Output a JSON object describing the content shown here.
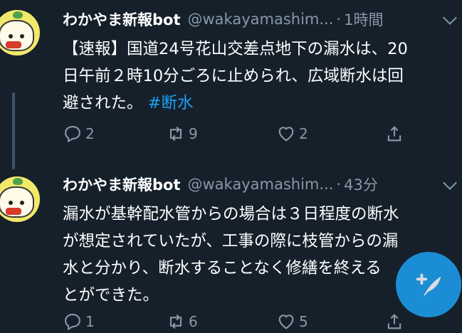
{
  "tweets": [
    {
      "name": "わかやま新報bot",
      "handle": "@wakayamashim...",
      "dot": "·",
      "time": "1時間",
      "lines": [
        "【速報】国道24号花山交差点地下の漏水は、20",
        "日午前２時10分ごろに止められ、広域断水は回"
      ],
      "last_line_text": "避された。",
      "hashtag": "#断水",
      "reply_count": "2",
      "retweet_count": "9",
      "like_count": "2",
      "icons": [
        "reply-icon",
        "retweet-icon",
        "like-icon",
        "share-icon"
      ]
    },
    {
      "name": "わかやま新報bot",
      "handle": "@wakayamashim...",
      "dot": "·",
      "time": "43分",
      "lines": [
        "漏水が基幹配水管からの場合は３日程度の断水",
        "が想定されていたが、工事の際に枝管からの漏",
        "水と分かり、断水することなく修繕を終える",
        "とができた。"
      ],
      "reply_count": "1",
      "retweet_count": "6",
      "like_count": "5",
      "icons": [
        "reply-icon",
        "retweet-icon",
        "like-icon",
        "share-icon"
      ]
    }
  ],
  "fab": {
    "icon": "compose-tweet-icon"
  },
  "colors": {
    "background": "#15202b",
    "accent": "#1da1f2",
    "secondary_text": "#8899a6"
  }
}
